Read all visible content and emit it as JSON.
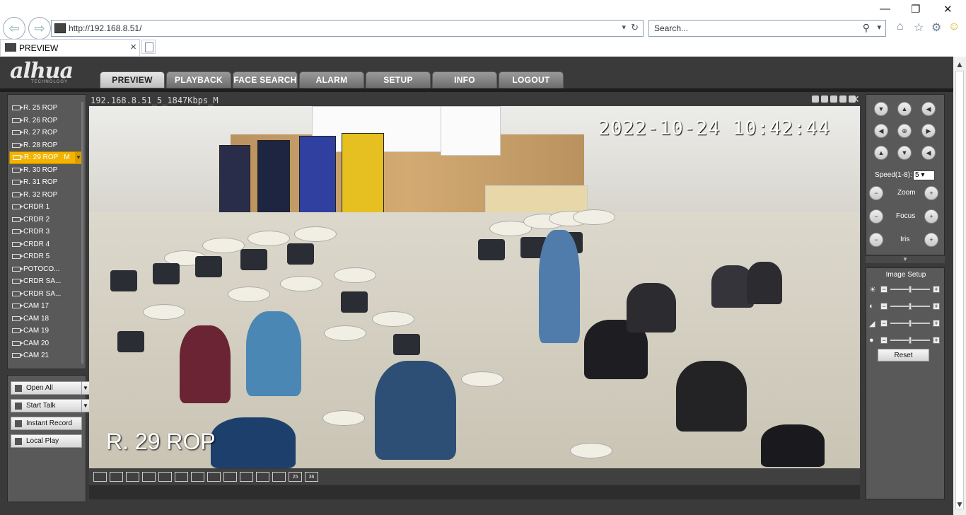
{
  "browser": {
    "url": "http://192.168.8.51/",
    "search_placeholder": "Search...",
    "tab_title": "PREVIEW",
    "tab_close": "×",
    "back_icon": "back-arrow-icon",
    "forward_icon": "forward-arrow-icon",
    "window_minimize": "—",
    "window_restore": "❐",
    "window_close": "✕"
  },
  "brand": {
    "logo": "alhua",
    "logo_sub": "TECHNOLOGY"
  },
  "nav": {
    "tabs": [
      {
        "label": "PREVIEW",
        "active": true
      },
      {
        "label": "PLAYBACK"
      },
      {
        "label": "FACE SEARCH"
      },
      {
        "label": "ALARM"
      },
      {
        "label": "SETUP"
      },
      {
        "label": "INFO"
      },
      {
        "label": "LOGOUT"
      }
    ]
  },
  "channels": [
    {
      "label": "R. 25 ROP"
    },
    {
      "label": "R. 26 ROP"
    },
    {
      "label": "R. 27 ROP"
    },
    {
      "label": "R. 28 ROP"
    },
    {
      "label": "R. 29 ROP",
      "selected": true,
      "stream": "M",
      "dropdown": "▼"
    },
    {
      "label": "R. 30 ROP"
    },
    {
      "label": "R. 31 ROP"
    },
    {
      "label": "R. 32 ROP"
    },
    {
      "label": "CRDR 1"
    },
    {
      "label": "CRDR 2"
    },
    {
      "label": "CRDR 3"
    },
    {
      "label": "CRDR 4"
    },
    {
      "label": "CRDR 5"
    },
    {
      "label": "POTOCO..."
    },
    {
      "label": "CRDR SA..."
    },
    {
      "label": "CRDR SA..."
    },
    {
      "label": "CAM 17"
    },
    {
      "label": "CAM 18"
    },
    {
      "label": "CAM 19"
    },
    {
      "label": "CAM 20"
    },
    {
      "label": "CAM 21"
    }
  ],
  "controls": {
    "open_all": "Open All",
    "start_talk": "Start Talk",
    "instant_record": "Instant Record",
    "local_play": "Local Play",
    "dropdown_glyph": "▼"
  },
  "video": {
    "title": "192.168.8.51_5_1847Kbps_M",
    "timestamp": "2022-10-24 10:42:44",
    "overlay_label": "R. 29 ROP",
    "close_glyph": "✕"
  },
  "layouts": [
    "1x1",
    "2x2",
    "full",
    "wide",
    "1",
    "4",
    "6",
    "8",
    "9",
    "13",
    "16",
    "20",
    "25",
    "36"
  ],
  "ptz": {
    "speed_label": "Speed(1-8):",
    "speed_value": "5",
    "zoom": "Zoom",
    "focus": "Focus",
    "iris": "Iris",
    "minus": "−",
    "plus": "+",
    "arrows": [
      "▼",
      "▲",
      "◀",
      "◀",
      "⊕",
      "▶",
      "▲",
      "▼",
      "◀"
    ]
  },
  "image_setup": {
    "title": "Image Setup",
    "rows": [
      {
        "icon": "☀",
        "level": 0.5
      },
      {
        "icon": "◐",
        "level": 0.5
      },
      {
        "icon": "◢",
        "level": 0.5
      },
      {
        "icon": "●",
        "level": 0.5
      }
    ],
    "reset": "Reset"
  },
  "colors": {
    "accent_selected": "#f2b400",
    "panel_bg": "#595959",
    "app_bg": "#3a3a3a"
  }
}
